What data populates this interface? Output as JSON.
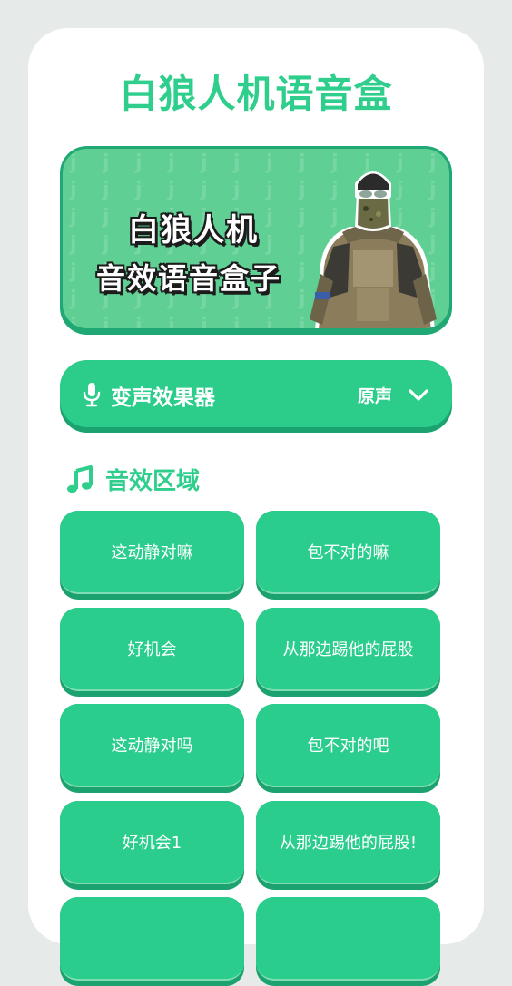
{
  "app": {
    "title": "白狼人机语音盒"
  },
  "banner": {
    "line1": "白狼人机",
    "line2": "音效语音盒子"
  },
  "voice_changer": {
    "label": "变声效果器",
    "selected": "原声",
    "icon": "microphone-icon"
  },
  "sound_section": {
    "title": "音效区域",
    "icon": "music-note-icon"
  },
  "sounds": [
    {
      "label": "这动静对嘛"
    },
    {
      "label": "包不对的嘛"
    },
    {
      "label": "好机会"
    },
    {
      "label": "从那边踢他的屁股"
    },
    {
      "label": "这动静对吗"
    },
    {
      "label": "包不对的吧"
    },
    {
      "label": "好机会1"
    },
    {
      "label": "从那边踢他的屁股!"
    }
  ],
  "colors": {
    "accent": "#2fce8c",
    "button": "#2bcd8c",
    "button_shadow": "#1ca26f",
    "background": "#e6ebe9"
  }
}
